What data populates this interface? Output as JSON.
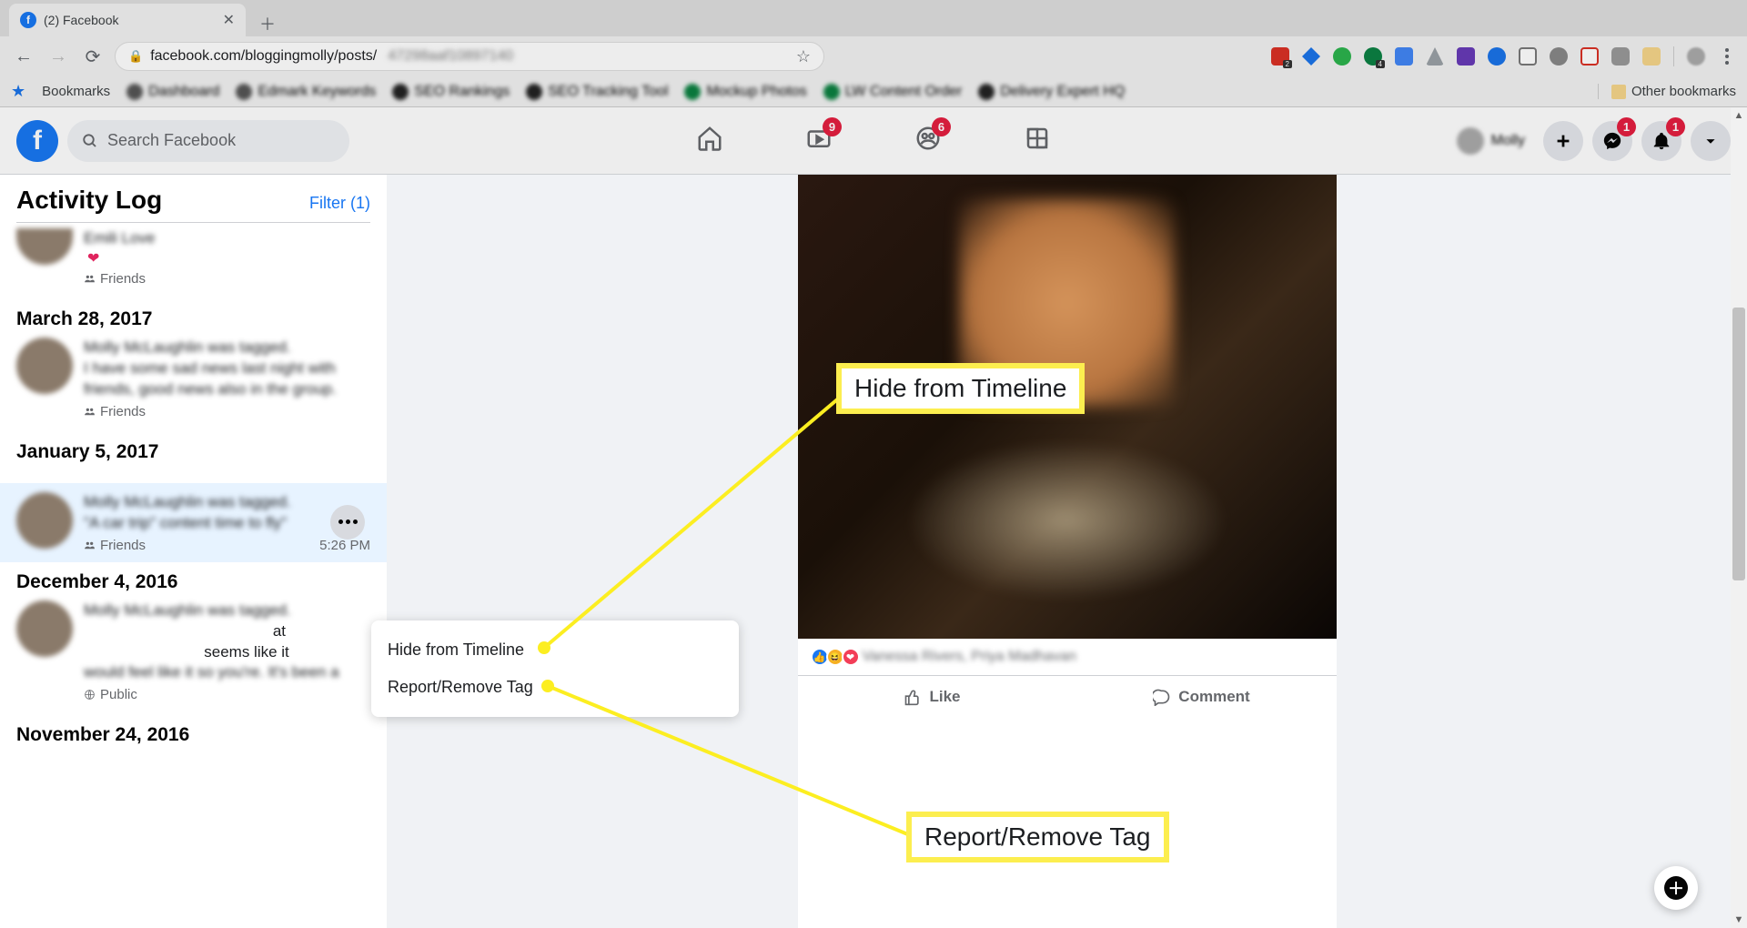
{
  "browser": {
    "tab_title": "(2) Facebook",
    "url_visible": "facebook.com/bloggingmolly/posts/",
    "bookmarks_label": "Bookmarks",
    "other_bookmarks": "Other bookmarks"
  },
  "fb_header": {
    "search_placeholder": "Search Facebook",
    "badges": {
      "watch": "9",
      "groups": "6",
      "messenger": "1",
      "notifications": "1"
    }
  },
  "sidebar": {
    "title": "Activity Log",
    "filter": "Filter (1)",
    "entries": [
      {
        "audience": "Friends"
      },
      {
        "date": "March 28, 2017",
        "audience": "Friends"
      },
      {
        "date": "January 5, 2017",
        "audience": "Friends",
        "time": "5:26 PM",
        "highlighted": true
      },
      {
        "date": "December 4, 2016",
        "audience": "Public"
      },
      {
        "date": "November 24, 2016"
      }
    ]
  },
  "ctx_menu": {
    "hide": "Hide from Timeline",
    "report": "Report/Remove Tag"
  },
  "post": {
    "like": "Like",
    "comment": "Comment"
  },
  "callouts": {
    "hide": "Hide from Timeline",
    "report": "Report/Remove Tag"
  }
}
